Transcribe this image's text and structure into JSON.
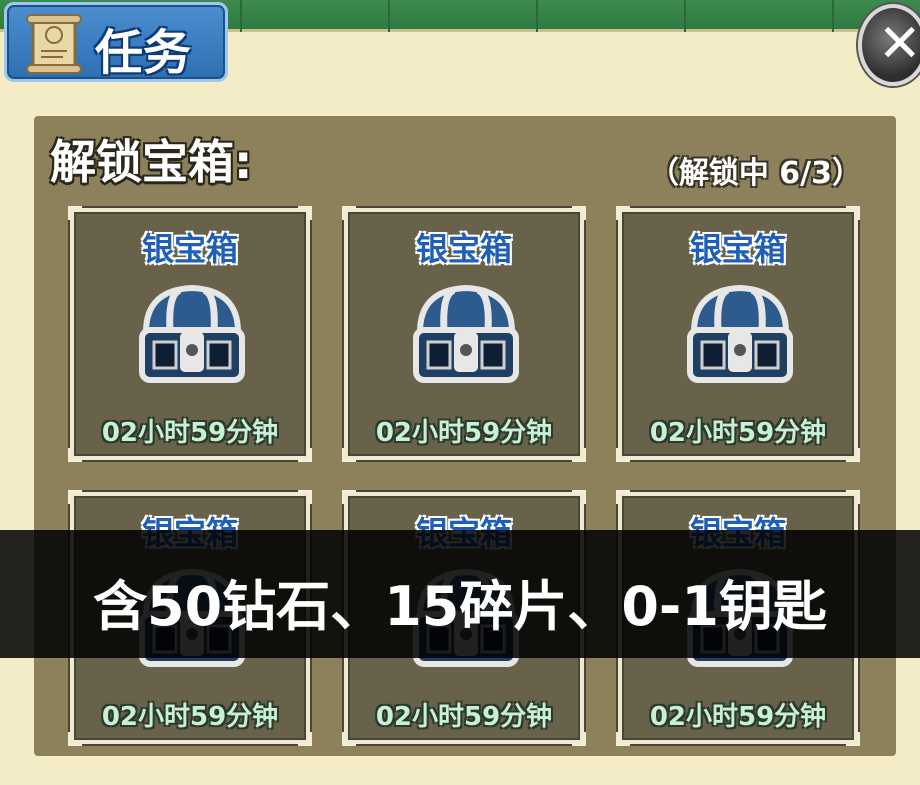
{
  "header": {
    "tab_title": "任务",
    "tab_icon": "scroll-icon",
    "close_icon": "close-icon",
    "close_glyph": "✕"
  },
  "panel": {
    "title": "解锁宝箱:",
    "unlock_status": "（解锁中 6/3）"
  },
  "chests": [
    {
      "name": "银宝箱",
      "timer": "02小时59分钟",
      "icon": "silver-chest-icon"
    },
    {
      "name": "银宝箱",
      "timer": "02小时59分钟",
      "icon": "silver-chest-icon"
    },
    {
      "name": "银宝箱",
      "timer": "02小时59分钟",
      "icon": "silver-chest-icon"
    },
    {
      "name": "银宝箱",
      "timer": "02小时59分钟",
      "icon": "silver-chest-icon"
    },
    {
      "name": "银宝箱",
      "timer": "02小时59分钟",
      "icon": "silver-chest-icon"
    },
    {
      "name": "银宝箱",
      "timer": "02小时59分钟",
      "icon": "silver-chest-icon"
    }
  ],
  "subtitle": "含50钻石、15碎片、0-1钥匙",
  "colors": {
    "tab_blue": "#2e6fb2",
    "chest_name_blue": "#1f5fb8",
    "panel_bg": "#8c815b",
    "card_bg": "#68624a",
    "page_bg": "#f3ecc6",
    "top_green": "#2f7a40"
  }
}
